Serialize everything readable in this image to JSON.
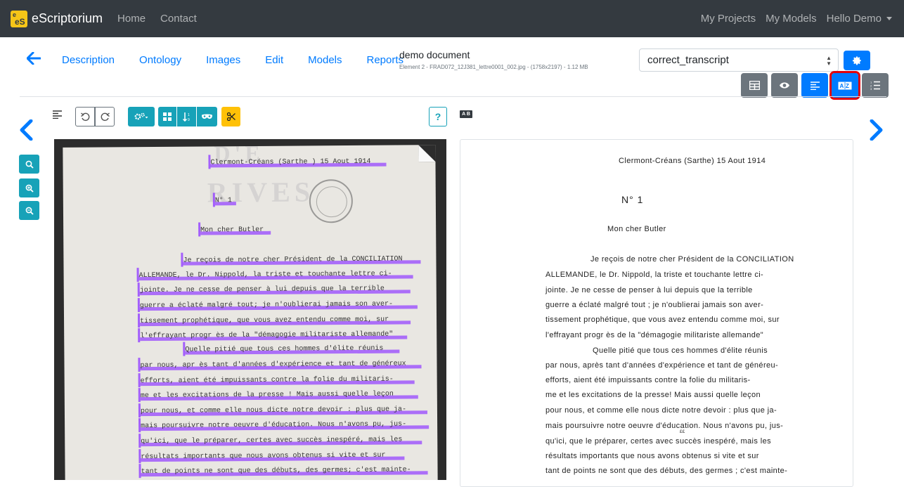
{
  "navbar": {
    "brand": "eScriptorium",
    "logo_small": "e",
    "logo_big": "eS",
    "home": "Home",
    "contact": "Contact",
    "my_projects": "My Projects",
    "my_models": "My Models",
    "user_menu": "Hello Demo"
  },
  "tabs": [
    "Description",
    "Ontology",
    "Images",
    "Edit",
    "Models",
    "Reports"
  ],
  "document": {
    "title": "demo document",
    "meta": "Element 2 - FRAD072_12J381_lettre0001_002.jpg - (1758x2197) - 1.12 MB"
  },
  "transcription_select": {
    "selected": "correct_transcript"
  },
  "view_buttons": [
    {
      "icon": "table-icon",
      "color": "gray"
    },
    {
      "icon": "eye-icon",
      "color": "gray"
    },
    {
      "icon": "align-left-icon",
      "color": "blue"
    },
    {
      "icon": "text-direction-icon",
      "color": "blue",
      "highlighted": true
    },
    {
      "icon": "ordered-list-icon",
      "color": "gray"
    }
  ],
  "toolbar": {
    "help": "?",
    "ab_label": "A B"
  },
  "image_lines": [
    "Clermont-Créans (Sarthe ) 15 Aout 1914",
    "N° 1",
    "Mon cher Butler",
    "Je reçois de notre cher Président de la CONCILIATION",
    "ALLEMANDE, le Dr. Nippold, la triste et touchante lettre ci-",
    "jointe. Je ne cesse de penser à lui depuis que la terrible",
    "guerre a éclaté malgré tout; je n'oublierai jamais son aver-",
    "tissement prophétique, que vous avez entendu comme moi, sur",
    "l'effrayant progr ès de la \"démagogie militariste allemande\"",
    "Quelle pitié que tous ces hommes d'élite réunis",
    "par nous, apr ès tant d'années d'expérience et tant de généreux",
    "efforts, aient été impuissants contre la folie du militaris-",
    "me et les excitations de la presse ! Mais aussi quelle leçon",
    "pour nous, et comme elle nous dicte notre devoir : plus que ja-",
    "mais poursuivre notre oeuvre d'éducation. Nous n'avons pu, jus-",
    "qu'ici, que le préparer, certes avec succès inespéré, mais les",
    "résultats importants que nous avons obtenus si vite et sur",
    "tant de points ne sont que des débuts, des germes; c'est mainte-"
  ],
  "image_ghost": "RIVES",
  "image_ghost2": "D'E",
  "transcript_lines": [
    "Clermont-Créans (Sarthe) 15 Aout 1914",
    "N° 1",
    "Mon cher Butler",
    "Je reçois de notre cher Président de la CONCILIATION",
    "ALLEMANDE, le Dr. Nippold, la triste et touchante lettre ci-",
    "jointe. Je ne cesse de penser à lui depuis que la terrible",
    "guerre a éclaté malgré tout ; je n'oublierai jamais son aver-",
    "tissement prophétique, que vous avez entendu comme moi, sur",
    "l'effrayant progr ès de la \"démagogie militariste allemande\"",
    "Quelle pitié que tous ces hommes d'élite réunis",
    "par nous, après tant d'années d'expérience et tant de généreu-",
    "efforts, aient été impuissants contre la folie du militaris-",
    "me et les excitations de la presse! Mais aussi quelle leçon",
    "pour nous, et comme elle nous dicte notre devoir : plus que ja-",
    "mais poursuivre notre oeuvre d'éducation. Nous n'avons pu, jus-",
    "qu'ici, que le préparer, certes avec succès inespéré, mais les",
    "résultats importants que nous avons obtenus si vite et sur",
    "tant de points ne sont que des débuts, des germes ; c'est mainte-"
  ],
  "transcript_annotation": "££"
}
